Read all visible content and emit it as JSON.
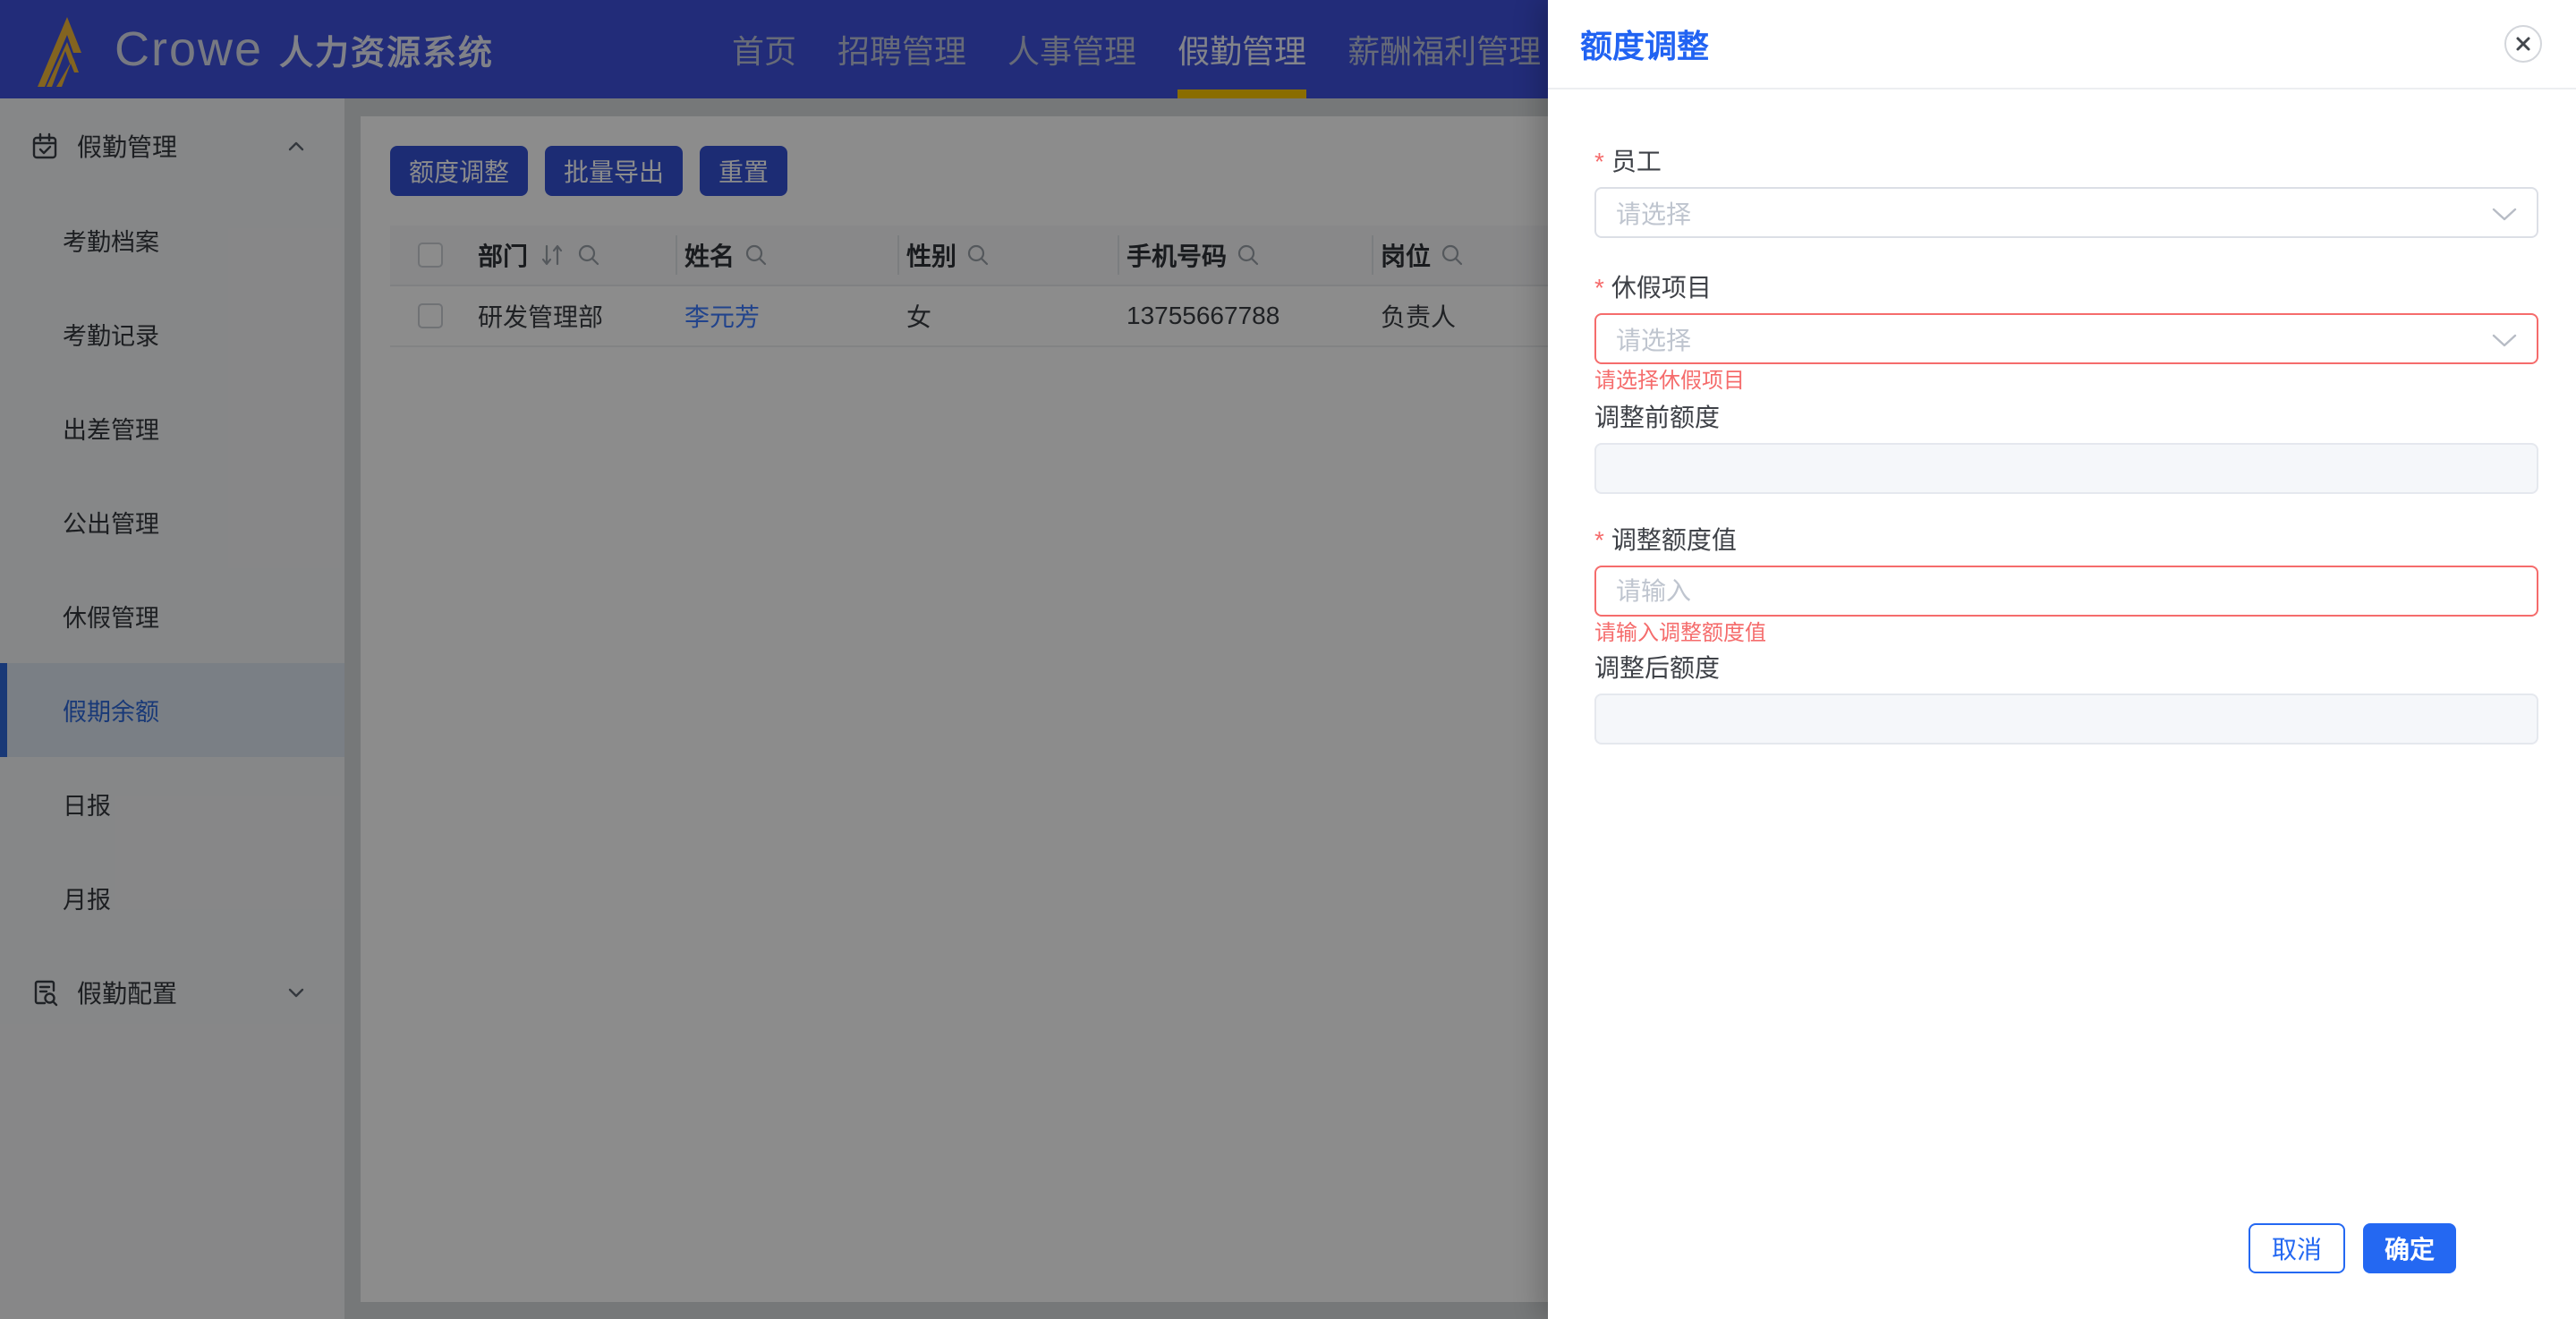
{
  "app": {
    "brand": "Crowe",
    "title": "人力资源系统"
  },
  "nav": {
    "items": [
      {
        "label": "首页",
        "active": false
      },
      {
        "label": "招聘管理",
        "active": false
      },
      {
        "label": "人事管理",
        "active": false
      },
      {
        "label": "假勤管理",
        "active": true
      },
      {
        "label": "薪酬福利管理",
        "active": false
      }
    ]
  },
  "sidebar": {
    "group1": {
      "label": "假勤管理",
      "items": [
        "考勤档案",
        "考勤记录",
        "出差管理",
        "公出管理",
        "休假管理",
        "假期余额",
        "日报",
        "月报"
      ],
      "selected_item": "假期余额"
    },
    "group2": {
      "label": "假勤配置"
    }
  },
  "toolbar": {
    "buttons": [
      "额度调整",
      "批量导出",
      "重置"
    ]
  },
  "table": {
    "columns": [
      "部门",
      "姓名",
      "性别",
      "手机号码",
      "岗位"
    ],
    "row": {
      "dept": "研发管理部",
      "name": "李元芳",
      "gender": "女",
      "phone": "13755667788",
      "post": "负责人"
    }
  },
  "drawer": {
    "title": "额度调整",
    "required_mark": "*",
    "fields": {
      "employee": {
        "label": "员工",
        "placeholder": "请选择"
      },
      "leave_item": {
        "label": "休假项目",
        "placeholder": "请选择",
        "error": "请选择休假项目"
      },
      "before_quota": {
        "label": "调整前额度",
        "value": ""
      },
      "adjust_value": {
        "label": "调整额度值",
        "placeholder": "请输入",
        "error": "请输入调整额度值"
      },
      "after_quota": {
        "label": "调整后额度",
        "value": ""
      }
    },
    "cancel_label": "取消",
    "confirm_label": "确定"
  },
  "colors": {
    "navbar": "#3E50DC",
    "nav_active_underline": "#FBC600",
    "primary": "#2468F2",
    "toolbar_button": "#3351D4",
    "sidebar_active": "#2E68D9",
    "link": "#3D7BFF",
    "error": "#F56C6C",
    "logo_gold": "#EFB63B"
  }
}
